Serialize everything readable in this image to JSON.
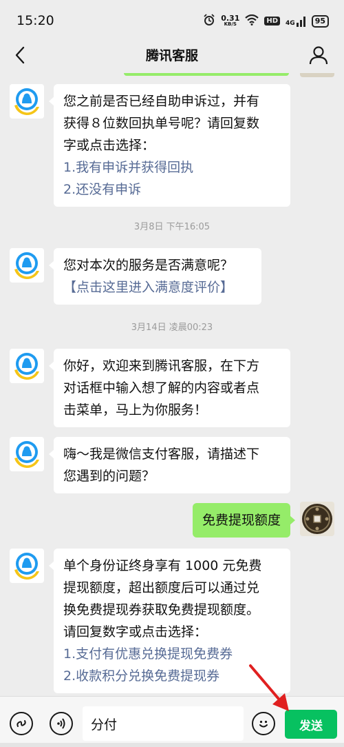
{
  "status_bar": {
    "time": "15:20",
    "net_speed_value": "0.31",
    "net_speed_unit": "KB/S",
    "hd_badge": "HD",
    "signal_label": "4G",
    "battery": "95"
  },
  "nav": {
    "title": "腾讯客服"
  },
  "messages": {
    "m1": {
      "line1": "您之前是否已经自助申诉过，并有",
      "line2": "获得８位数回执单号呢？请回复数",
      "line3": "字或点击选择：",
      "option1": "1.我有申诉并获得回执",
      "option2": "2.还没有申诉"
    },
    "t1": "3月8日 下午16:05",
    "m2": {
      "line1": "您对本次的服务是否满意呢？",
      "link": "【点击这里进入满意度评价】"
    },
    "t2": "3月14日 凌晨00:23",
    "m3": {
      "line1": "你好，欢迎来到腾讯客服，在下方",
      "line2": "对话框中输入想了解的内容或者点",
      "line3": "击菜单，马上为你服务！"
    },
    "m4": {
      "line1": "嗨～我是微信支付客服，请描述下",
      "line2": "您遇到的问题？"
    },
    "m5": {
      "text": "免费提现额度"
    },
    "m6": {
      "line1": "单个身份证终身享有 1000 元免费",
      "line2": "提现额度，超出额度后可以通过兑",
      "line3": "换免费提现券获取免费提现额度。",
      "line4": "请回复数字或点击选择：",
      "option1": "1.支付有优惠兑换提现免费券",
      "option2": "2.收款积分兑换免费提现券"
    }
  },
  "input_bar": {
    "value": "分付",
    "send_label": "发送"
  },
  "colors": {
    "my_bubble": "#95ec69",
    "send_button": "#07c160",
    "link": "#576b95",
    "annotation_arrow": "#e02020"
  },
  "icons": [
    "back-icon",
    "profile-icon",
    "service-avatar-icon",
    "mini-program-icon",
    "voice-icon",
    "emoji-icon",
    "wifi-icon",
    "alarm-icon",
    "signal-icon",
    "battery-icon"
  ]
}
